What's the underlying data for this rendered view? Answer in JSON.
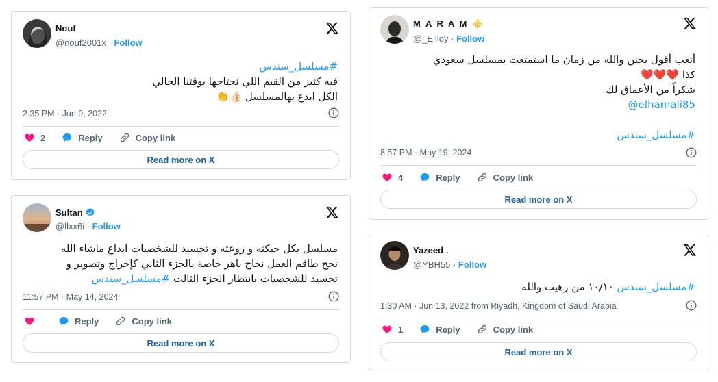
{
  "colors": {
    "accent": "#1d9bf0",
    "heart": "#f91880",
    "text": "#0f1419",
    "muted": "#536471",
    "border": "#cfd9de"
  },
  "common": {
    "follow": "Follow",
    "reply": "Reply",
    "copy_link": "Copy link",
    "read_more": "Read more on X"
  },
  "tweets": [
    {
      "name": "Nouf",
      "handle": "@nouf2001x",
      "hashtag": "#مسلسل_سندس",
      "line1": "فيه كثير من القيم اللي نحتاجها بوقتنا الحالي",
      "line2": "الكل ابدع بهالمسلسل 👍🏻👏",
      "timestamp": "2:35 PM · Jun 9, 2022",
      "likes": "2"
    },
    {
      "name": "Sultan",
      "verified": true,
      "handle": "@llxx6i",
      "line1": "مسلسل بكل حبكته و روعته و تجسيد للشخصيات ابداع ماشاء الله",
      "line2": "نجح طاقم العمل نجاح باهر خاصة بالجزء الثاني كإخراج وتصوير و",
      "line3": "تجسيد للشخصيات بانتظار الجزء الثالث",
      "hashtag": "#مسلسل_سندس",
      "timestamp": "11:57 PM · May 14, 2024",
      "likes": ""
    },
    {
      "name": "M A R A M ⚜️",
      "handle": "@_Ellloy",
      "line1": "أتعب أقول يجنن والله من زمان ما استمتعت بمسلسل سعودي",
      "line2": "كذا ❤️❤️❤️",
      "line3": "شكراً من الأعماق لك",
      "mention": "@elhamali85",
      "hashtag": "#مسلسل_سندس",
      "timestamp": "8:57 PM · May 19, 2024",
      "likes": "4"
    },
    {
      "name": "Yazeed .",
      "handle": "@YBH55",
      "hashtag": "#مسلسل_سندس",
      "text": "١٠/١٠ من رهيب والله",
      "timestamp": "1:30 AM · Jun 13, 2022 from Riyadh, Kingdom of Saudi Arabia",
      "likes": "1"
    }
  ]
}
